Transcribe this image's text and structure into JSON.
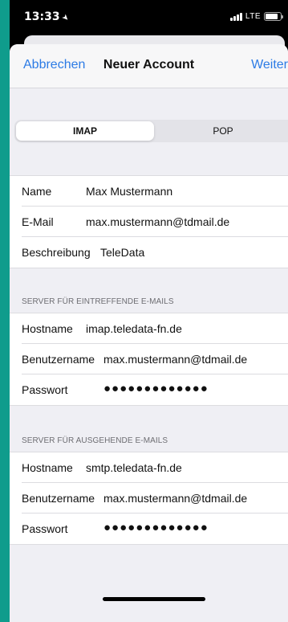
{
  "status": {
    "time": "13:33",
    "network": "LTE",
    "battery_level": 0.85
  },
  "nav": {
    "cancel": "Abbrechen",
    "title": "Neuer Account",
    "next": "Weiter"
  },
  "segments": [
    {
      "label": "IMAP",
      "selected": true
    },
    {
      "label": "POP",
      "selected": false
    }
  ],
  "account": {
    "name_label": "Name",
    "name_value": "Max Mustermann",
    "email_label": "E-Mail",
    "email_value": "max.mustermann@tdmail.de",
    "desc_label": "Beschreibung",
    "desc_value": "TeleData"
  },
  "incoming": {
    "header": "SERVER FÜR EINTREFFENDE E-MAILS",
    "host_label": "Hostname",
    "host_value": "imap.teledata-fn.de",
    "user_label": "Benutzername",
    "user_value": "max.mustermann@tdmail.de",
    "pass_label": "Passwort",
    "pass_value": "●●●●●●●●●●●●●"
  },
  "outgoing": {
    "header": "SERVER FÜR AUSGEHENDE E-MAILS",
    "host_label": "Hostname",
    "host_value": "smtp.teledata-fn.de",
    "user_label": "Benutzername",
    "user_value": "max.mustermann@tdmail.de",
    "pass_label": "Passwort",
    "pass_value": "●●●●●●●●●●●●●"
  },
  "colors": {
    "accent": "#2c7be5",
    "background": "#0f9c8c",
    "grouped_bg": "#efeff4"
  },
  "icons": [
    "location-arrow-icon",
    "signal-icon",
    "battery-icon"
  ]
}
